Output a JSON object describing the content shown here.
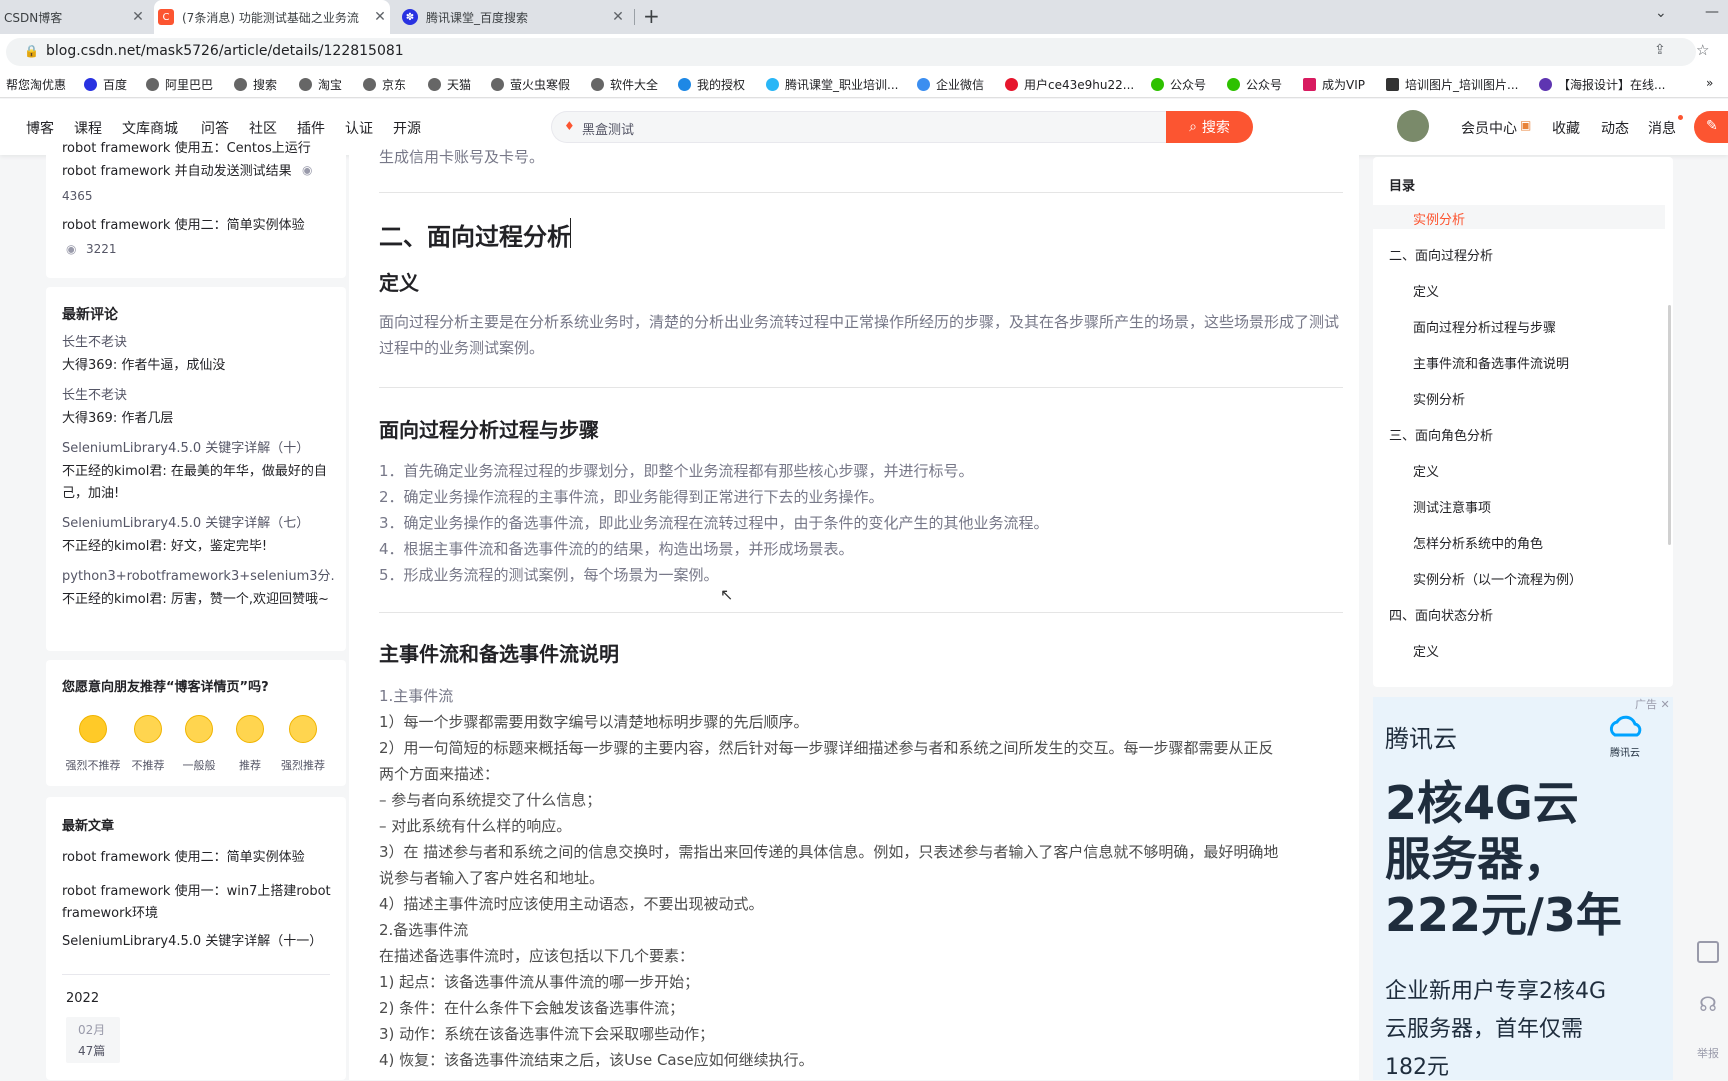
{
  "browser": {
    "tabs": [
      {
        "title": "CSDN博客",
        "active": false
      },
      {
        "title": "(7条消息) 功能测试基础之业务流",
        "active": true
      },
      {
        "title": "腾讯课堂_百度搜索",
        "active": false
      }
    ],
    "new_tab": "+",
    "url": "blog.csdn.net/mask5726/article/details/122815081",
    "bookmarks": [
      "帮您淘优惠",
      "百度",
      "阿里巴巴",
      "搜索",
      "淘宝",
      "京东",
      "天猫",
      "萤火虫寒假",
      "软件大全",
      "我的授权",
      "腾讯课堂_职业培训...",
      "企业微信",
      "用户ce43e9hu22...",
      "公众号",
      "公众号",
      "成为VIP",
      "培训图片_培训图片...",
      "【海报设计】在线..."
    ]
  },
  "nav": {
    "links": [
      "博客",
      "课程",
      "文库商城",
      "问答",
      "社区",
      "插件",
      "认证",
      "开源"
    ],
    "search_value": "黑盒测试",
    "search_button": "搜索",
    "right": [
      "会员中心",
      "收藏",
      "动态",
      "消息"
    ]
  },
  "sidebar": {
    "hot": {
      "clipped": "robot framework 使用五：Centos上运行",
      "items": [
        {
          "title": "robot framework 并自动发送测试结果",
          "views": "4365"
        },
        {
          "title": "robot framework 使用二：简单实例体验",
          "views": "3221"
        }
      ]
    },
    "comments": {
      "title": "最新评论",
      "items": [
        {
          "post": "长生不老诀",
          "text": "大得369: 作者牛逼，成仙没"
        },
        {
          "post": "长生不老诀",
          "text": "大得369: 作者几层"
        },
        {
          "post": "SeleniumLibrary4.5.0 关键字详解（十）",
          "text": "不正经的kimol君: 在最美的年华，做最好的自己，加油!"
        },
        {
          "post": "SeleniumLibrary4.5.0 关键字详解（七）",
          "text": "不正经的kimol君: 好文，鉴定完毕!"
        },
        {
          "post": "python3+robotframework3+selenium3分...",
          "text": "不正经的kimol君: 厉害，赞一个,欢迎回赞哦~"
        }
      ]
    },
    "recommend": {
      "title": "您愿意向朋友推荐“博客详情页”吗?",
      "options": [
        "强烈不推荐",
        "不推荐",
        "一般般",
        "推荐",
        "强烈推荐"
      ]
    },
    "recent": {
      "title": "最新文章",
      "items": [
        "robot framework 使用二：简单实例体验",
        "robot framework 使用一：win7上搭建robot framework环境",
        "SeleniumLibrary4.5.0 关键字详解（十一）"
      ]
    },
    "archive": {
      "year": "2022",
      "month": "02月",
      "count": "47篇"
    }
  },
  "article": {
    "top_clip": "生成信用卡账号及卡号。",
    "section_title": "二、面向过程分析",
    "def_title": "定义",
    "def_text": "面向过程分析主要是在分析系统业务时，清楚的分析出业务流转过程中正常操作所经历的步骤，及其在各步骤所产生的场景，这些场景形成了测试过程中的业务测试案例。",
    "steps_title": "面向过程分析过程与步骤",
    "steps": [
      "1．首先确定业务流程过程的步骤划分，即整个业务流程都有那些核心步骤，并进行标号。",
      "2．确定业务操作流程的主事件流，即业务能得到正常进行下去的业务操作。",
      "3．确定业务操作的备选事件流，即此业务流程在流转过程中，由于条件的变化产生的其他业务流程。",
      "4．根据主事件流和备选事件流的的结果，构造出场景，并形成场景表。",
      "5．形成业务流程的测试案例，每个场景为一案例。"
    ],
    "flow_title": "主事件流和备选事件流说明",
    "flow_lines": [
      "1.主事件流",
      "1）每一个步骤都需要用数字编号以清楚地标明步骤的先后顺序。",
      "2）用一句简短的标题来概括每一步骤的主要内容，然后针对每一步骤详细描述参与者和系统之间所发生的交互。每一步骤都需要从正反",
      "两个方面来描述：",
      "– 参与者向系统提交了什么信息；",
      "– 对此系统有什么样的响应。",
      "3）在 描述参与者和系统之间的信息交换时，需指出来回传递的具体信息。例如，只表述参与者输入了客户信息就不够明确，最好明确地",
      "说参与者输入了客户姓名和地址。",
      "4）描述主事件流时应该使用主动语态，不要出现被动式。",
      "2.备选事件流",
      "在描述备选事件流时，应该包括以下几个要素：",
      "1) 起点：该备选事件流从事件流的哪一步开始；",
      "2) 条件：在什么条件下会触发该备选事件流；",
      "3) 动作：系统在该备选事件流下会采取哪些动作；",
      "4) 恢复：该备选事件流结束之后，该Use Case应如何继续执行。"
    ]
  },
  "toc": {
    "title": "目录",
    "items": [
      "实例分析",
      "二、面向过程分析",
      "定义",
      "面向过程分析过程与步骤",
      "主事件流和备选事件流说明",
      "实例分析",
      "三、面向角色分析",
      "定义",
      "测试注意事项",
      "怎样分析系统中的角色",
      "实例分析（以一个流程为例）",
      "四、面向状态分析",
      "定义"
    ]
  },
  "ad": {
    "tag": "广告",
    "brand": "腾讯云",
    "logo_text": "腾讯云",
    "headline": [
      "2核4G云",
      "服务器，",
      "222元/3年"
    ],
    "sub": [
      "企业新用户专享2核4G",
      "云服务器，首年仅需",
      "182元"
    ]
  },
  "float": {
    "report": "举报"
  },
  "colors": {
    "accent": "#fc5531",
    "toc_active": "#fc5531",
    "ad_text": "#1f2d3d"
  }
}
